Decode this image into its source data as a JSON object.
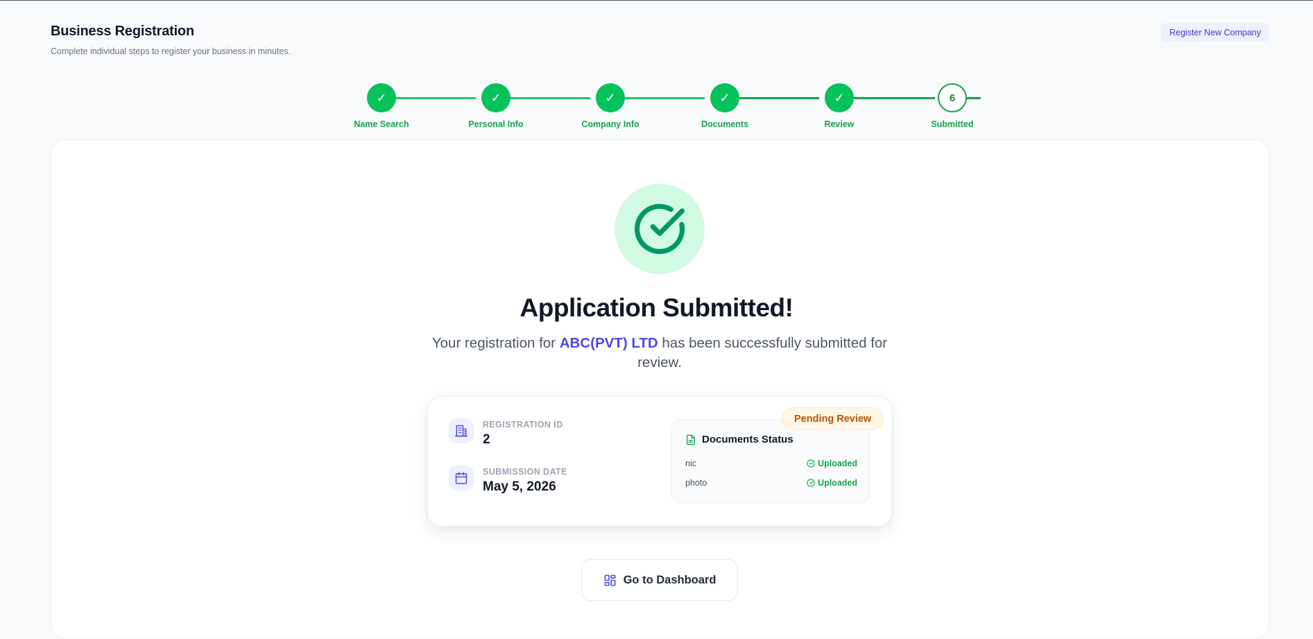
{
  "header": {
    "title": "Business Registration",
    "subtitle": "Complete individual steps to register your business in minutes.",
    "register_button": "Register New Company"
  },
  "stepper": {
    "steps": [
      {
        "label": "Name Search",
        "state": "complete",
        "marker": "✓"
      },
      {
        "label": "Personal Info",
        "state": "complete",
        "marker": "✓"
      },
      {
        "label": "Company Info",
        "state": "complete",
        "marker": "✓"
      },
      {
        "label": "Documents",
        "state": "complete",
        "marker": "✓"
      },
      {
        "label": "Review",
        "state": "complete",
        "marker": "✓"
      },
      {
        "label": "Submitted",
        "state": "current",
        "marker": "6"
      }
    ]
  },
  "success": {
    "icon": "check-circle-icon",
    "title": "Application Submitted!",
    "message_prefix": "Your registration for",
    "company_name": "ABC(PVT) LTD",
    "message_suffix": "has been successfully submitted for review."
  },
  "summary": {
    "registration_id_label": "REGISTRATION ID",
    "registration_id": "2",
    "submission_date_label": "SUBMISSION DATE",
    "submission_date": "May 5, 2026",
    "status_badge": "Pending Review",
    "documents": {
      "title": "Documents Status",
      "items": [
        {
          "name": "nic",
          "status": "Uploaded"
        },
        {
          "name": "photo",
          "status": "Uploaded"
        }
      ]
    }
  },
  "actions": {
    "dashboard_button": "Go to Dashboard"
  },
  "colors": {
    "brand": "#4f46e5",
    "success": "#16a34a",
    "pending": "#b45309"
  }
}
